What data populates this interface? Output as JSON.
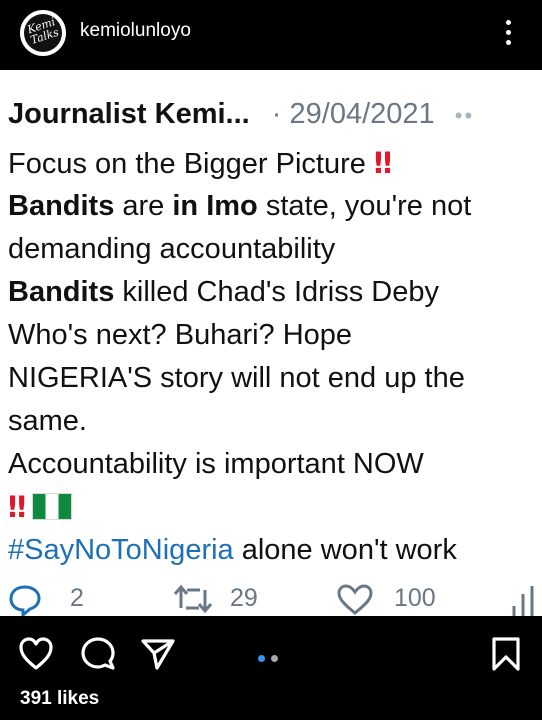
{
  "header": {
    "avatar_text": "Kemi Talks",
    "username": "kemiolunloyo"
  },
  "tweet": {
    "author": "Journalist Kemi...",
    "separator": "·",
    "date": "29/04/2021",
    "more": "••",
    "lines": {
      "l1": "Focus on the Bigger Picture ",
      "l1_emoji": "‼",
      "l2_a": "Bandits",
      "l2_b": " are ",
      "l2_c": "in Imo",
      "l2_d": " state, you're not",
      "l3": "demanding accountability",
      "l4_a": "Bandits",
      "l4_b": " killed Chad's Idriss Deby",
      "l5": "Who's next? Buhari? Hope",
      "l6": "NIGERIA'S story will not end up the",
      "l7": "same.",
      "l8": "Accountability is important NOW",
      "l9_emoji": "‼",
      "l10_hashtag": "#SayNoToNigeria",
      "l10_rest": " alone won't work"
    },
    "actions": {
      "replies": "2",
      "retweets": "29",
      "likes": "100"
    }
  },
  "footer": {
    "likes_label": "391 likes"
  },
  "colors": {
    "background": "#000000",
    "tweet_bg": "#ffffff",
    "hashtag": "#1d6fb8",
    "muted": "#6b7784",
    "pager_active": "#3797f0",
    "flag_green": "#0e8a3e"
  }
}
